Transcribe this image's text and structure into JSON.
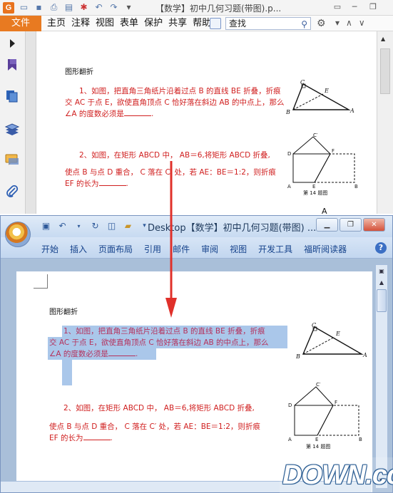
{
  "pdf_window": {
    "logo": "G",
    "title": "【数学】初中几何习题(带图).p...",
    "file_tab": "文件",
    "menus": [
      "主页",
      "注释",
      "视图",
      "表单",
      "保护",
      "共享",
      "帮助"
    ],
    "search_placeholder": "查找",
    "icons": [
      "open-icon",
      "save-icon",
      "print-icon",
      "scan-icon",
      "stamp-icon",
      "undo-icon",
      "redo-icon"
    ]
  },
  "document": {
    "heading": "图形翻折",
    "q1": {
      "line1": "1、如图，把直角三角纸片沿着过点 B 的直线 BE 折叠，折痕",
      "line2": "交 AC 于点 E，欲使直角顶点 C 恰好落在斜边 AB 的中点上，那么",
      "line3": "∠A 的度数必须是"
    },
    "q2": {
      "line1": "2、如图，在矩形 ABCD 中， AB＝6,将矩形 ABCD 折叠,",
      "line2_pdf": "使点 B 与点 D 重合， C 落在 C′ 处，若 AE：BE＝1:2，则折痕",
      "line2_word": "使点 B 与点 D 重合， C 落在 C′ 处，若 AE：BE＝1:2，则折痕",
      "line3": "EF 的长为"
    },
    "fig1": {
      "c": "C",
      "e": "E",
      "b": "B",
      "a": "A"
    },
    "fig2": {
      "cprime": "C′",
      "d": "D",
      "f": "F",
      "a": "A",
      "e": "E",
      "b": "B",
      "caption": "第 14 题图"
    },
    "next_label": "A"
  },
  "word_window": {
    "title": "Desktop【数学】初中几何习题(带图) ...",
    "tabs": [
      "开始",
      "插入",
      "页面布局",
      "引用",
      "邮件",
      "审阅",
      "视图",
      "开发工具",
      "福昕阅读器"
    ],
    "help": "?"
  },
  "watermark": "DOWN.cc",
  "colors": {
    "accent": "#e87a21",
    "text_red": "#d01f1f",
    "selection": "#aac7ea",
    "ribbon_text": "#15428b"
  }
}
